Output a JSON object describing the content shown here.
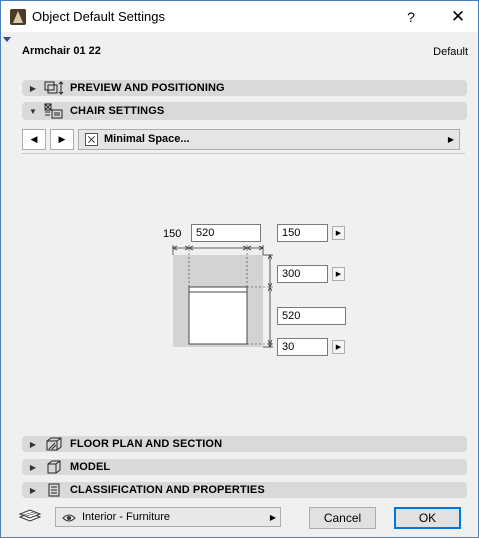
{
  "window": {
    "title": "Object Default Settings",
    "help_label": "?",
    "close_label": "✕"
  },
  "object": {
    "name": "Armchair 01 22",
    "mode": "Default"
  },
  "sections": {
    "preview": "PREVIEW AND POSITIONING",
    "chair": "CHAIR SETTINGS",
    "floor": "FLOOR PLAN AND SECTION",
    "model": "MODEL",
    "classification": "CLASSIFICATION AND PROPERTIES"
  },
  "page_selector": {
    "prev_label": "◀",
    "next_label": "▶",
    "current": "Minimal Space..."
  },
  "dimensions": {
    "left_offset": "150",
    "width": "520",
    "right_offset": "150",
    "back_space": "300",
    "depth": "520",
    "front_space": "30"
  },
  "footer": {
    "layer": "Interior - Furniture",
    "cancel_label": "Cancel",
    "ok_label": "OK"
  },
  "colors": {
    "accent": "#0078d7",
    "section_bg": "#d9d9d9",
    "diagram_gray": "#d3d3d3"
  }
}
